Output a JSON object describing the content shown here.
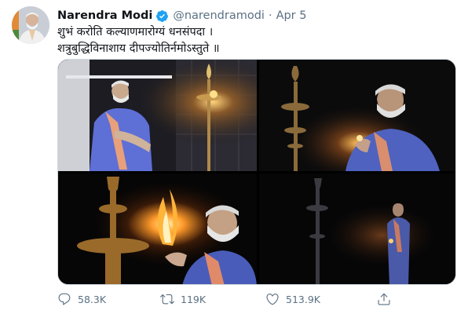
{
  "tweet": {
    "author_name": "Narendra Modi",
    "handle": "@narendramodi",
    "separator": "·",
    "date": "Apr 5",
    "text_line1": "शुभं करोति कल्याणमारोग्यं धनसंपदा ।",
    "text_line2": "शत्रुबुद्धिविनाशाय दीपज्योतिर्नमोऽस्तुते ॥"
  },
  "actions": {
    "replies": "58.3K",
    "retweets": "119K",
    "likes": "513.9K"
  },
  "colors": {
    "text": "#0f1419",
    "muted": "#5b7083",
    "verified": "#1da1f2",
    "border": "#cfd9de"
  },
  "icons": [
    "verified-badge-icon",
    "reply-icon",
    "retweet-icon",
    "like-icon",
    "share-icon"
  ]
}
